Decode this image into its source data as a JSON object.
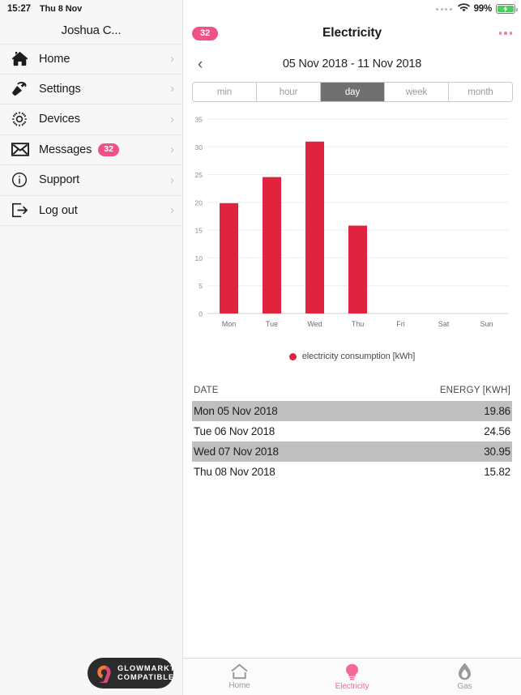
{
  "status_bar": {
    "time": "15:27",
    "date": "Thu 8 Nov",
    "battery_percent": "99%",
    "wifi_icon": "wifi-icon",
    "battery_icon": "battery-charging-icon",
    "signal_icon": "signal-dots-icon"
  },
  "sidebar": {
    "account_name": "Joshua C...",
    "items": [
      {
        "label": "Home",
        "icon": "house-icon",
        "badge": ""
      },
      {
        "label": "Settings",
        "icon": "hammer-icon",
        "badge": ""
      },
      {
        "label": "Devices",
        "icon": "gear-icon",
        "badge": ""
      },
      {
        "label": "Messages",
        "icon": "envelope-icon",
        "badge": "32"
      },
      {
        "label": "Support",
        "icon": "info-circle-icon",
        "badge": ""
      },
      {
        "label": "Log out",
        "icon": "logout-icon",
        "badge": ""
      }
    ],
    "chevron": "›",
    "partner_badge": {
      "line1": "GLOWMARKT",
      "line2": "COMPATIBLE",
      "logo": "glowmarkt-g-logo"
    }
  },
  "header": {
    "message_badge": "32",
    "title": "Electricity",
    "more_icon": "kebab-menu-icon"
  },
  "date_nav": {
    "prev_icon": "chevron-left-icon",
    "range": "05 Nov 2018 - 11 Nov 2018"
  },
  "period_selector": {
    "options": [
      "min",
      "hour",
      "day",
      "week",
      "month"
    ],
    "selected": "day"
  },
  "chart_data": {
    "type": "bar",
    "title": "",
    "categories": [
      "Mon",
      "Tue",
      "Wed",
      "Thu",
      "Fri",
      "Sat",
      "Sun"
    ],
    "values": [
      19.86,
      24.56,
      30.95,
      15.82,
      null,
      null,
      null
    ],
    "series": [
      {
        "name": "electricity consumption [kWh]",
        "values": [
          19.86,
          24.56,
          30.95,
          15.82,
          null,
          null,
          null
        ],
        "color": "#e0243f"
      }
    ],
    "xlabel": "",
    "ylabel": "",
    "ylim": [
      0,
      35
    ],
    "yticks": [
      0,
      5,
      10,
      15,
      20,
      25,
      30,
      35
    ],
    "ytick_labels": [
      "0",
      "5",
      "10",
      "15",
      "20",
      "25",
      "30",
      "35"
    ],
    "grid": true,
    "legend": [
      {
        "label": "electricity consumption [kWh]",
        "color": "#e0243f"
      }
    ],
    "legend_position": "bottom"
  },
  "table": {
    "columns": [
      "DATE",
      "ENERGY [KWH]"
    ],
    "rows": [
      {
        "date": "Mon 05 Nov 2018",
        "energy": "19.86"
      },
      {
        "date": "Tue 06 Nov 2018",
        "energy": "24.56"
      },
      {
        "date": "Wed 07 Nov 2018",
        "energy": "30.95"
      },
      {
        "date": "Thu 08 Nov 2018",
        "energy": "15.82"
      }
    ]
  },
  "tabbar": {
    "tabs": [
      {
        "label": "Home",
        "icon": "house-outline-icon",
        "active": false
      },
      {
        "label": "Electricity",
        "icon": "lightbulb-icon",
        "active": true
      },
      {
        "label": "Gas",
        "icon": "flame-icon",
        "active": false
      }
    ]
  },
  "colors": {
    "accent_pink": "#ef5289",
    "bar_red": "#e0243f",
    "segment_active": "#707070",
    "row_alt": "#bfbfbf"
  }
}
